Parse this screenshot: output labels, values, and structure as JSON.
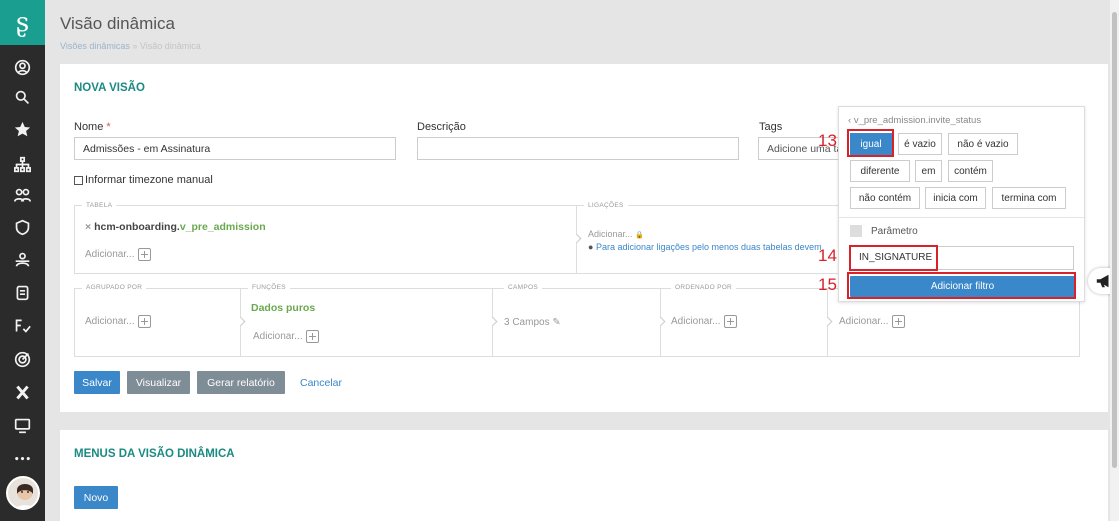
{
  "page": {
    "title": "Visão dinâmica",
    "crumb_link": "Visões dinâmicas",
    "crumb_sep": " » ",
    "crumb_current": "Visão dinâmica"
  },
  "sidebar": {
    "icons": [
      "logo-icon",
      "user-circle-icon",
      "search-icon",
      "star-icon",
      "org-chart-icon",
      "people-icon",
      "shield-icon",
      "team-icon",
      "building-icon",
      "user-check-icon",
      "target-icon",
      "x-icon",
      "monitor-icon",
      "more-icon"
    ],
    "more_label": "•••"
  },
  "form": {
    "section_title": "NOVA VISÃO",
    "name_label": "Nome",
    "required_mark": "*",
    "name_value": "Admissões - em Assinatura",
    "desc_label": "Descrição",
    "desc_value": "",
    "tags_label": "Tags",
    "tags_placeholder": "Adicione uma tag",
    "timezone_label": "Informar timezone manual"
  },
  "tabela": {
    "legend": "TABELA",
    "remove": "×",
    "schema": "hcm-onboarding.",
    "table": "v_pre_admission",
    "add": "Adicionar..."
  },
  "ligacoes": {
    "legend": "LIGAÇÕES",
    "add": "Adicionar...",
    "lock": "🔒",
    "info": "Para adicionar ligações pelo menos duas tabelas devem"
  },
  "row2": {
    "agrupado_legend": "AGRUPADO POR",
    "agrupado_add": "Adicionar...",
    "funcoes_legend": "FUNÇÕES",
    "funcoes_item": "Dados puros",
    "funcoes_add": "Adicionar...",
    "campos_legend": "CAMPOS",
    "campos_value": "3 Campos",
    "ordenado_legend": "ORDENADO POR",
    "ordenado_add": "Adicionar...",
    "last_add": "Adicionar..."
  },
  "actions": {
    "save": "Salvar",
    "view": "Visualizar",
    "report": "Gerar relatório",
    "cancel": "Cancelar"
  },
  "menus": {
    "title": "MENUS DA VISÃO DINÂMICA",
    "new": "Novo"
  },
  "filter": {
    "back": "‹",
    "field": "v_pre_admission.invite_status",
    "operators": [
      "igual",
      "é vazio",
      "não é vazio",
      "diferente",
      "em",
      "contém",
      "não contém",
      "inicia com",
      "termina com"
    ],
    "selected": "igual",
    "param_label": "Parâmetro",
    "value": "IN_SIGNATURE",
    "add": "Adicionar filtro"
  },
  "annotations": {
    "n13": "13",
    "n14": "14",
    "n15": "15",
    "color": "#d8222a"
  },
  "colors": {
    "accent": "#1a8a82",
    "primary": "#3a87c9",
    "sidebar": "#2b2b2b",
    "logo": "#1a9e8f"
  }
}
